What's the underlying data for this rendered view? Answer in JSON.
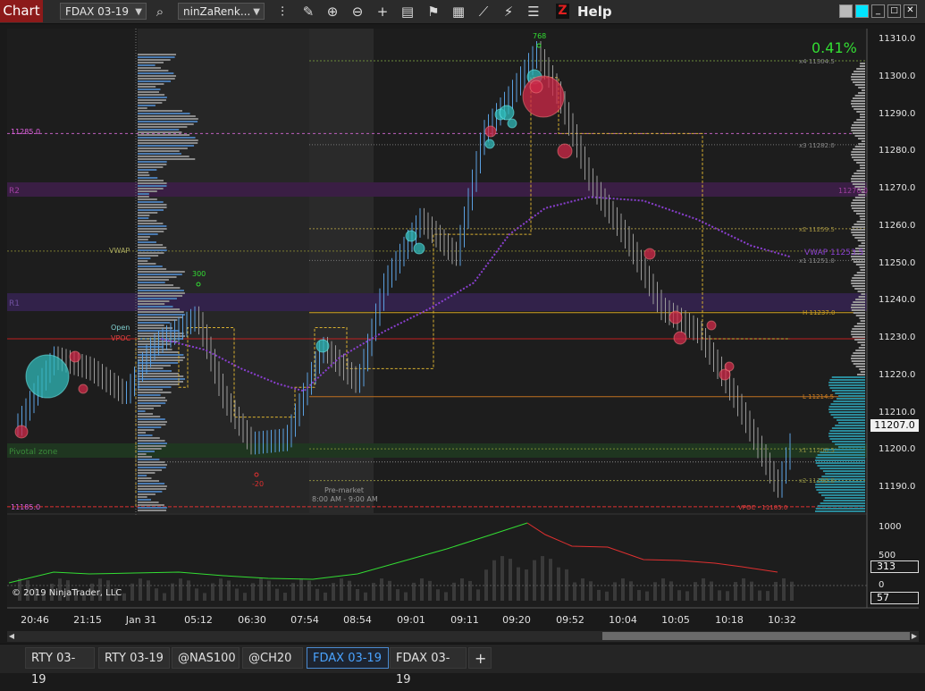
{
  "toolbar": {
    "chart_label": "Chart",
    "instrument": "FDAX 03-19",
    "bar_type": "ninZaRenk...",
    "help_label": "Help",
    "help_logo": "Z"
  },
  "price_axis": {
    "ticks": [
      "11310.0",
      "11300.0",
      "11290.0",
      "11280.0",
      "11270.0",
      "11260.0",
      "11250.0",
      "11240.0",
      "11230.0",
      "11220.0",
      "11210.0",
      "11200.0",
      "11190.0"
    ],
    "current_price": "11207.0",
    "change_pct": "0.41%"
  },
  "volume_axis": {
    "ticks": [
      "1000",
      "500",
      "0"
    ],
    "current_volume": "313",
    "current_delta": "57"
  },
  "time_axis": [
    "20:46",
    "21:15",
    "Jan 31",
    "05:12",
    "06:30",
    "07:54",
    "08:54",
    "09:01",
    "09:11",
    "09:20",
    "09:52",
    "10:04",
    "10:05",
    "10:18",
    "10:32"
  ],
  "labels": {
    "left_11285": "11285.0",
    "vwap": "VWAP",
    "open": "Open",
    "vpoc": "VPOC",
    "pivotal_zone": "Pivotal zone",
    "left_11185": "11185.0",
    "r2": "R2",
    "r1": "R1",
    "premarket_title": "Pre-market",
    "premarket_time": "8:00 AM - 9:00 AM",
    "peak_768": "768",
    "low_300": "300",
    "low_20": "-20",
    "copyright": "© 2019 NinjaTrader, LLC",
    "x4": "x4 11304.5",
    "x3": "x3 11282.0",
    "r2_right": "11270.0",
    "x2_top": "x2 11259.5",
    "vwap_right": "VWAP 11253.5",
    "x1_top": "x1 11251.0",
    "h": "H 11237.0",
    "l": "L 11214.5",
    "x1_bot": "x1 11200.5",
    "x2_bot": "x2 11192.0",
    "vpoc_right": "VPOC - 11185.0"
  },
  "bottom_tabs": [
    {
      "label": "RTY 03-19"
    },
    {
      "label": "RTY 03-19"
    },
    {
      "label": "@NAS100"
    },
    {
      "label": "@CH20"
    },
    {
      "label": "FDAX 03-19"
    },
    {
      "label": "FDAX 03-19"
    },
    {
      "label": "+"
    }
  ],
  "colors": {
    "up_bar": "#5aa0e0",
    "down_bar": "#9a9a9a",
    "vwap": "#8a3fd0",
    "bubble_buy": "#2fb8b8",
    "bubble_sell": "#d02848",
    "accent_green": "#33dd33"
  }
}
